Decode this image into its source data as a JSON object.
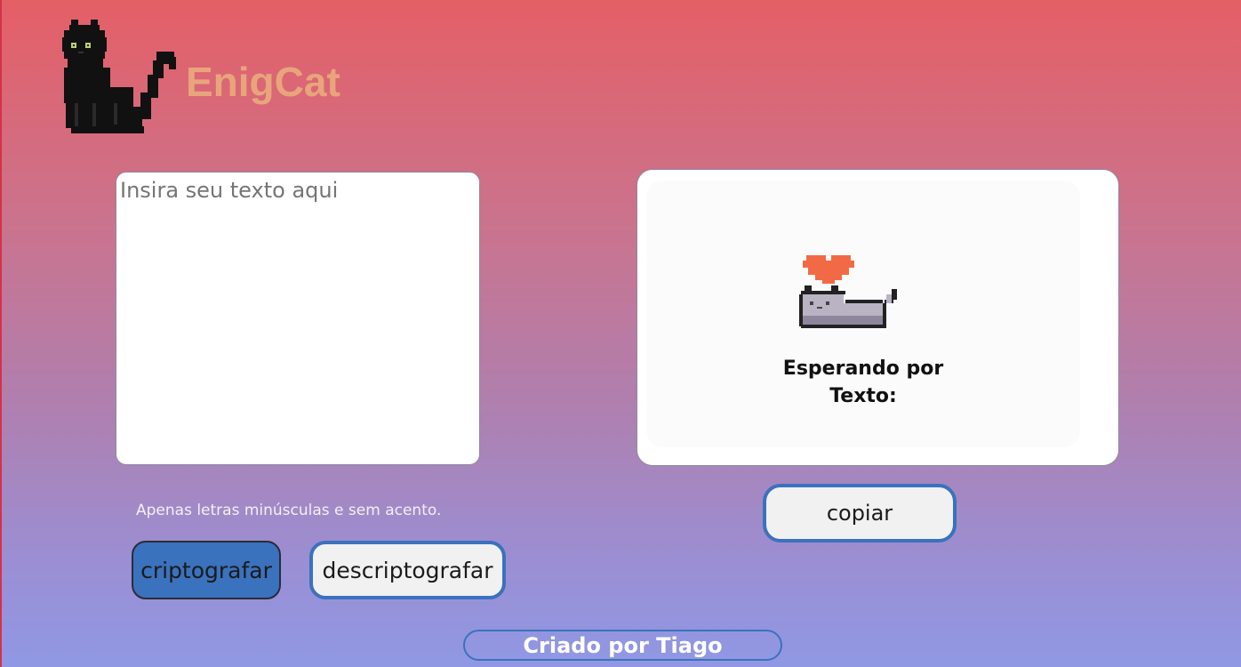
{
  "header": {
    "logo_icon": "pixel-black-cat-icon",
    "brand_name": "EnigCat",
    "brand_color": "#e8a57c"
  },
  "input": {
    "placeholder": "Insira seu texto aqui",
    "value": ""
  },
  "output": {
    "illustration_icon": "pixel-cat-heart-icon",
    "waiting_line1": "Esperando por",
    "waiting_line2": "Texto:"
  },
  "hint": "Apenas letras minúsculas e sem acento.",
  "buttons": {
    "encrypt_label": "criptografar",
    "decrypt_label": "descriptografar",
    "copy_label": "copiar",
    "accent_color": "#3a72bd"
  },
  "footer": {
    "credit": "Criado por Tiago"
  }
}
